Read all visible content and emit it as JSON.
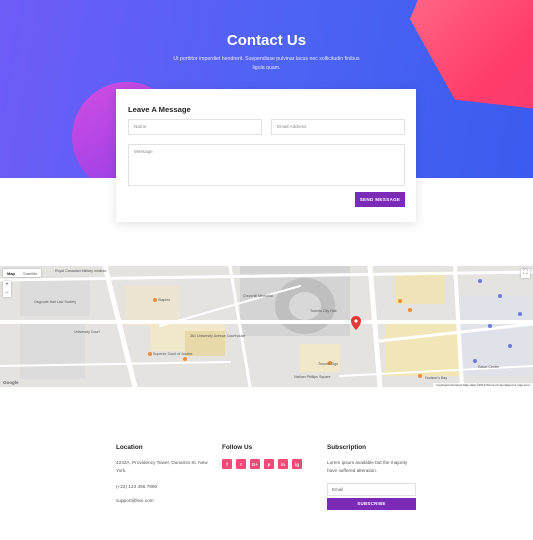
{
  "hero": {
    "title": "Contact Us",
    "subtitle": "Ut porttitor imperdiet hendrerit. Suspendisse pulvinar lacus nec sollicitudin finibus ligula quam."
  },
  "form": {
    "title": "Leave A Message",
    "name_placeholder": "Name",
    "email_placeholder": "Email Address",
    "message_placeholder": "Message",
    "send_label": "SEND MESSAGE"
  },
  "map": {
    "type_map": "Map",
    "type_satellite": "Satellite",
    "zoom_in": "+",
    "zoom_out": "−",
    "fullscreen": "⛶",
    "google": "Google",
    "footer_text": "Keyboard shortcuts  Map data ©2019  Terms of Use  Report a map error",
    "labels": [
      "Royal Canadian Military Institute",
      "Osgoode Hall Law Society",
      "University Court",
      "Staples",
      "Churchill Memorial",
      "Toronto City Hall",
      "Superior Court of Justice",
      "361 University Avenue Courthouse",
      "Nathan Phillips Square",
      "Toronto Sign",
      "Eaton Centre",
      "Hudson's Bay"
    ]
  },
  "footer": {
    "location": {
      "title": "Location",
      "address": "4232A, Providency Tower, Dunamis St. New York.",
      "phone": "(+22) 123 456 7890",
      "email": "support@lexi.com"
    },
    "follow": {
      "title": "Follow Us",
      "icons": [
        "f",
        "t",
        "G+",
        "p",
        "in",
        "ig"
      ]
    },
    "subscription": {
      "title": "Subscription",
      "text": "Lorem ipsum available but the majority have suffered alteration.",
      "email_placeholder": "Email",
      "button_label": "SUBSCRIBE"
    }
  },
  "colors": {
    "hero_start": "#6f5cf7",
    "hero_end": "#3a5bf0",
    "accent_purple": "#7c2bb8",
    "accent_pink": "#f04b77"
  }
}
